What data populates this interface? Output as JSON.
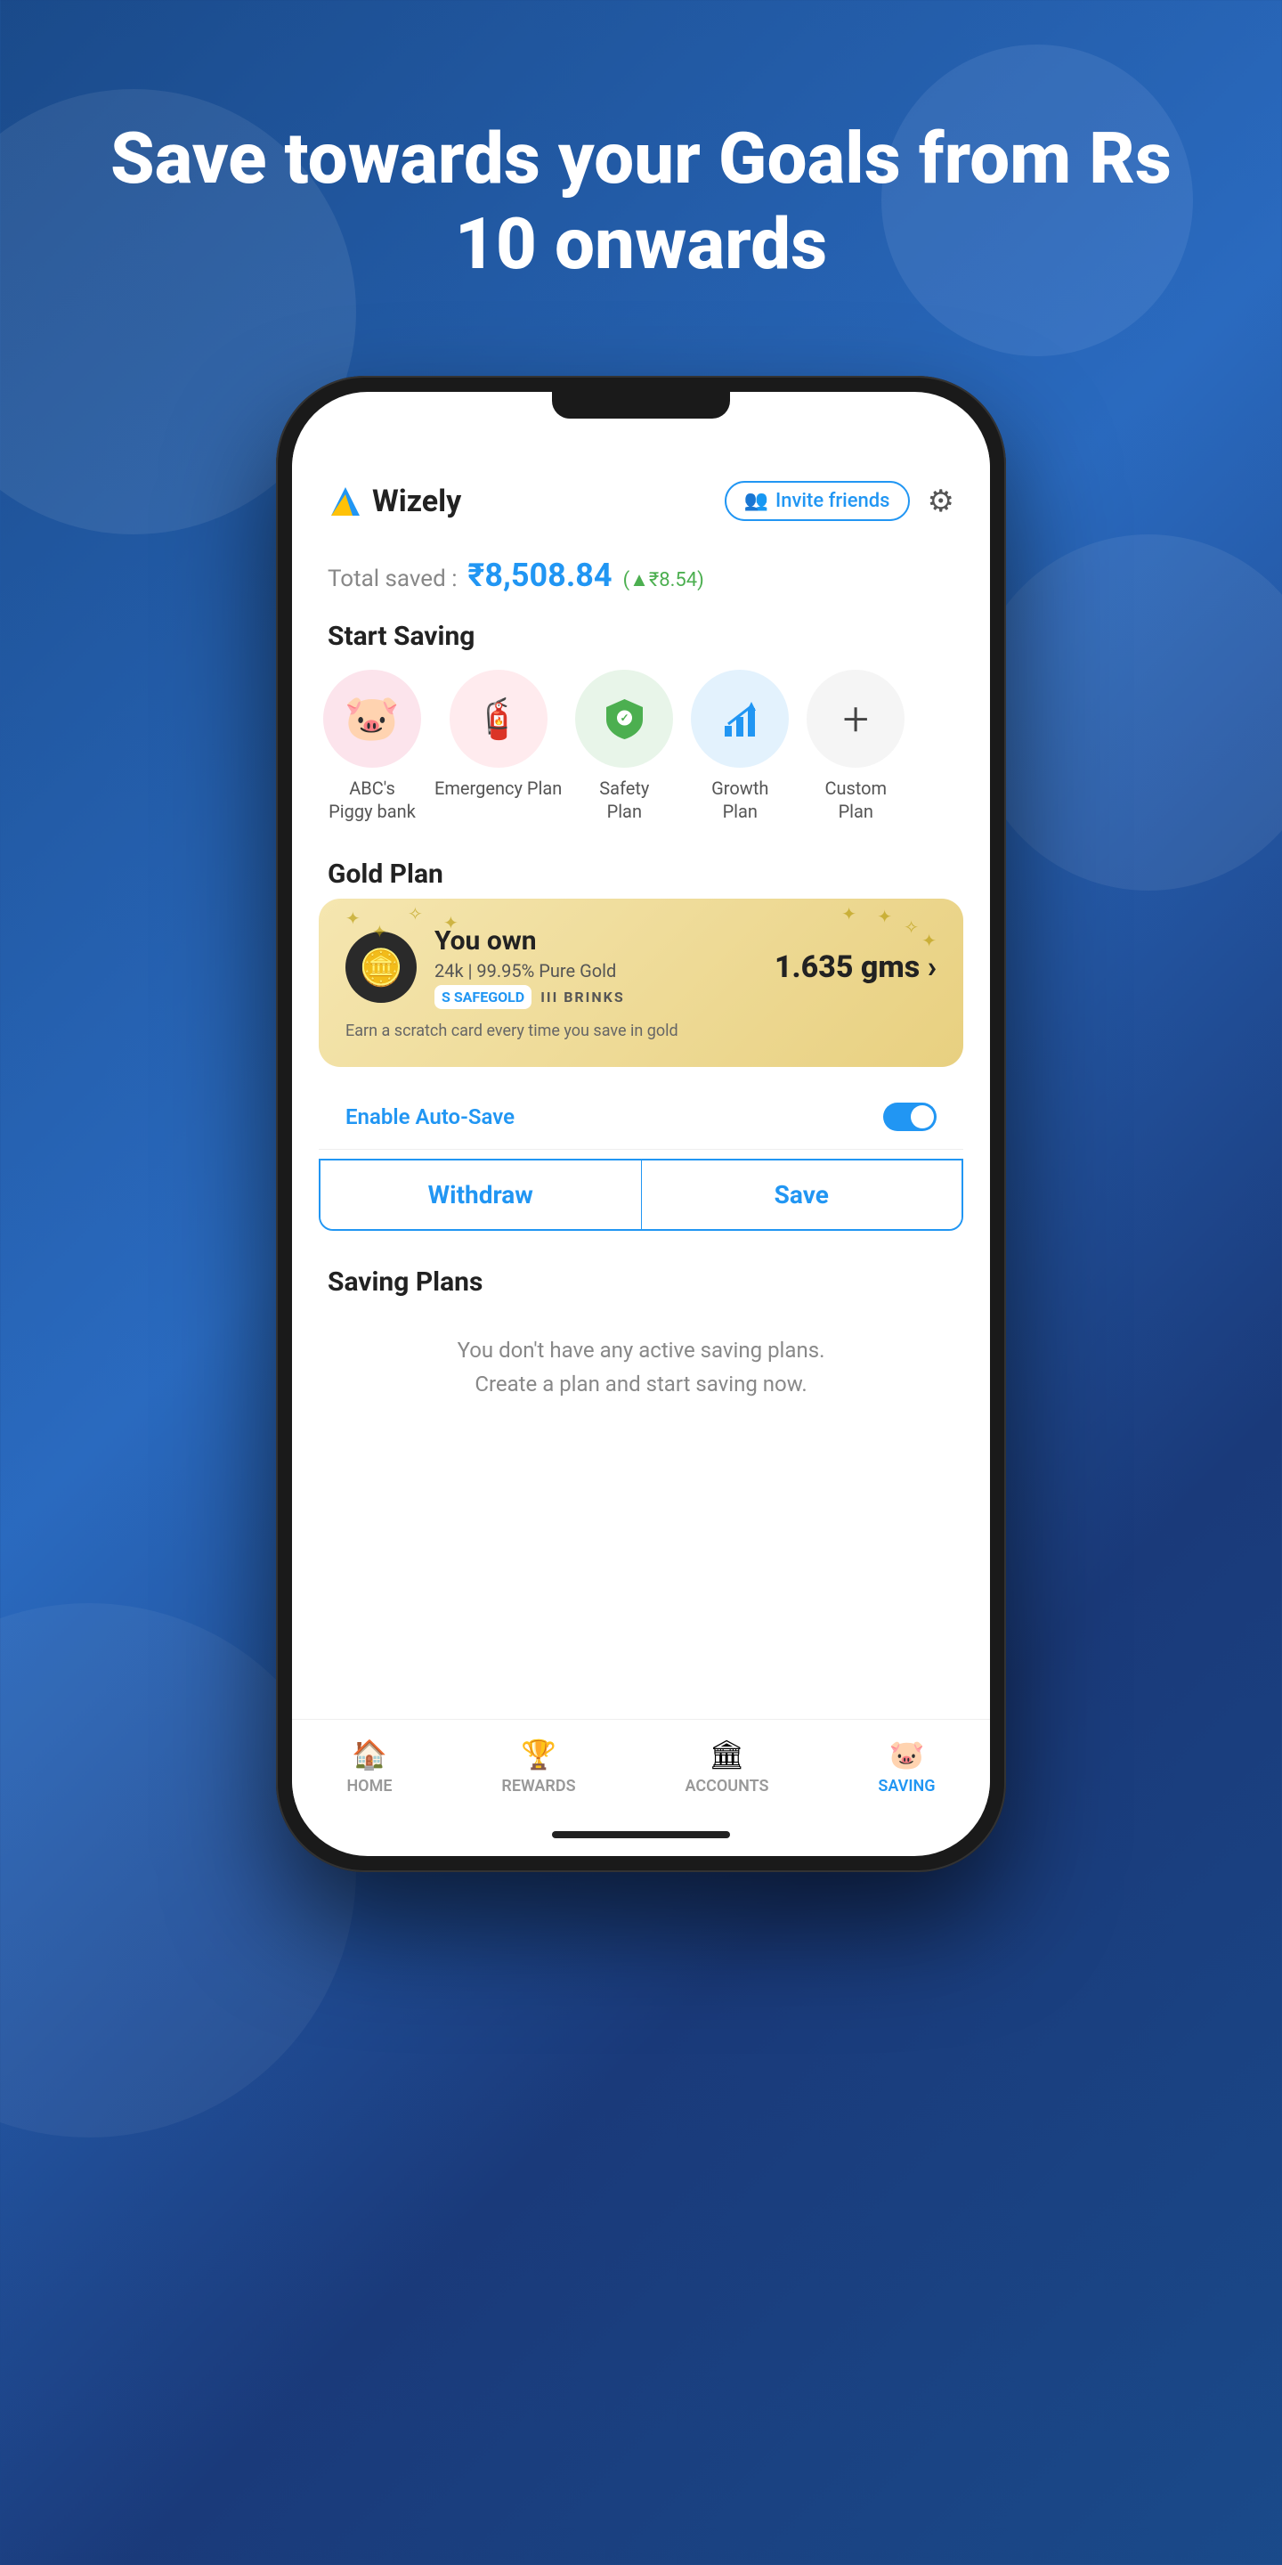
{
  "hero": {
    "title": "Save towards your Goals from Rs 10 onwards"
  },
  "app": {
    "name": "Wizely",
    "header": {
      "invite_label": "Invite friends",
      "settings_label": "Settings"
    },
    "total_saved": {
      "label": "Total saved :",
      "amount": "₹8,508.84",
      "change": "(▲₹8.54)"
    },
    "start_saving": {
      "title": "Start Saving",
      "items": [
        {
          "label": "ABC's\nPiggy bank",
          "icon": "🐷",
          "circle": "pink"
        },
        {
          "label": "Emergency\nPlan",
          "icon": "🧯",
          "circle": "salmon"
        },
        {
          "label": "Safety\nPlan",
          "icon": "🛡️",
          "circle": "green"
        },
        {
          "label": "Growth\nPlan",
          "icon": "📈",
          "circle": "blue"
        },
        {
          "label": "Custom\nPlan",
          "icon": "+",
          "circle": "gray"
        }
      ]
    },
    "gold_plan": {
      "title": "Gold Plan",
      "you_own": "You own",
      "amount": "1.635 gms ›",
      "purity": "24k | 99.95% Pure Gold",
      "scratch_text": "Earn a scratch card every time you save in gold",
      "auto_save_label": "Enable Auto-Save",
      "withdraw_label": "Withdraw",
      "save_label": "Save",
      "brand1": "S SAFEGOLD",
      "brand2": "IIIBRINKS"
    },
    "saving_plans": {
      "title": "Saving Plans",
      "empty_text": "You don't have any active saving plans.\nCreate a plan and start saving now."
    },
    "bottom_nav": {
      "items": [
        {
          "label": "HOME",
          "icon": "⌂",
          "active": false
        },
        {
          "label": "REWARDS",
          "icon": "🏆",
          "active": false
        },
        {
          "label": "ACCOUNTS",
          "icon": "🏛",
          "active": false
        },
        {
          "label": "SAVING",
          "icon": "🐷",
          "active": true
        }
      ]
    }
  }
}
